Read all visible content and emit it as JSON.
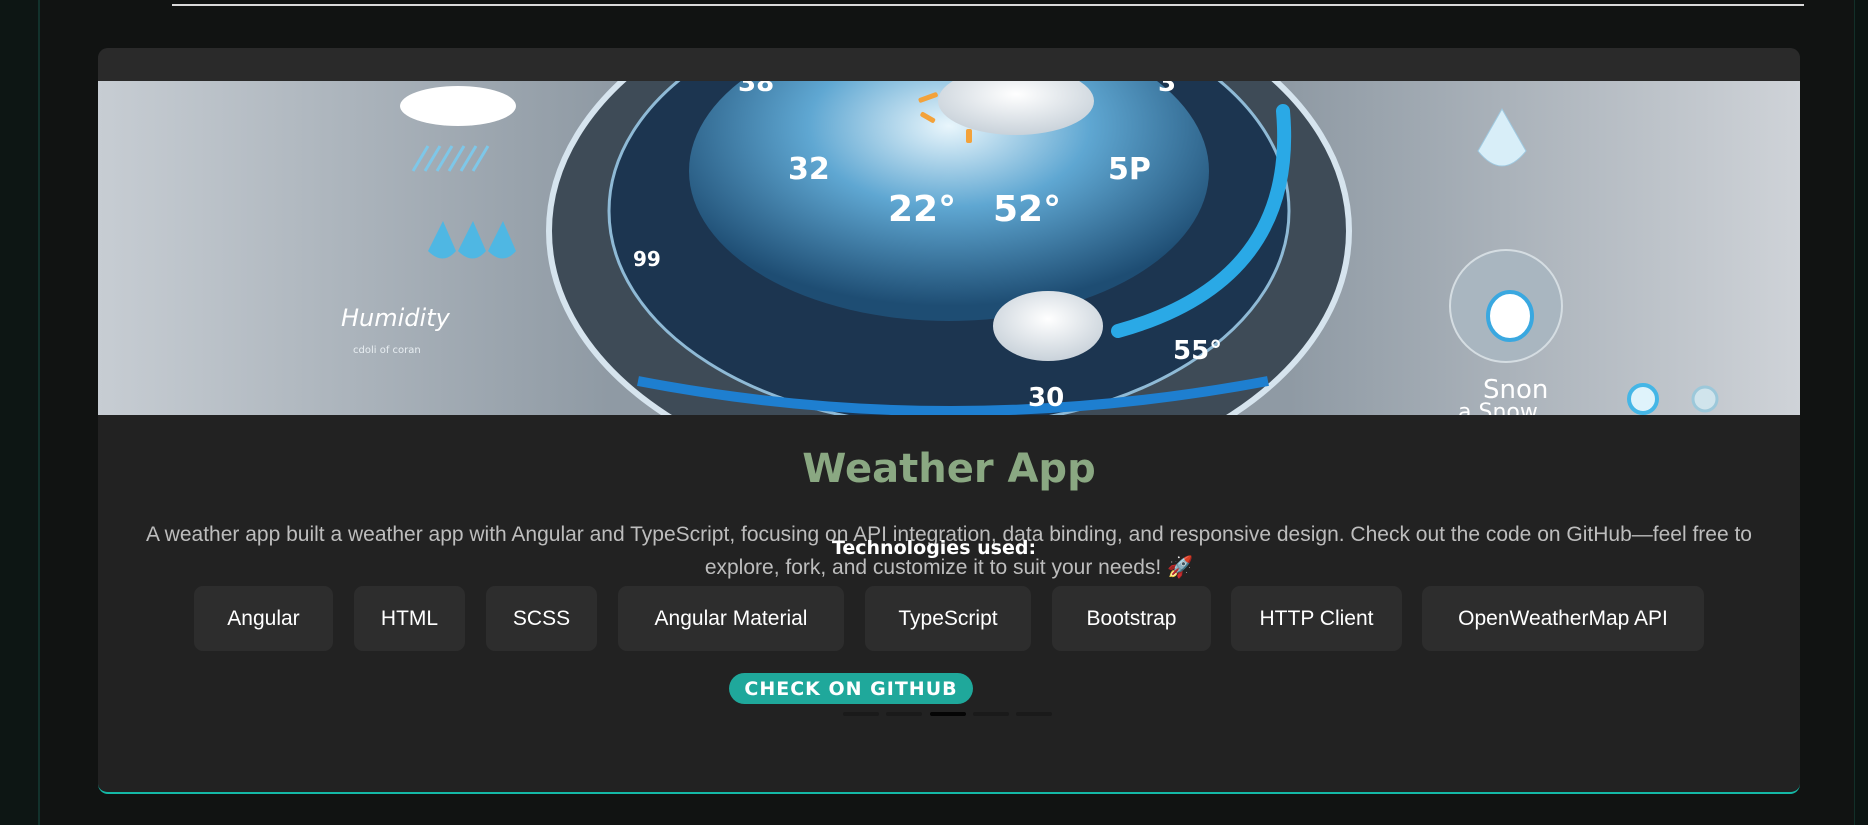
{
  "project": {
    "title": "Weather App",
    "description": "A weather app built a weather app with Angular and TypeScript, focusing on API integration, data binding, and responsive design. Check out the code on GitHub—feel free to explore, fork, and customize it to suit your needs! 🚀",
    "technologies_heading": "Technologies used:",
    "technologies": [
      "Angular",
      "HTML",
      "SCSS",
      "Angular Material",
      "TypeScript",
      "Bootstrap",
      "HTTP Client",
      "OpenWeatherMap API"
    ],
    "github_button": "CHECK ON GITHUB",
    "carousel": {
      "total": 5,
      "active": 3
    }
  },
  "banner": {
    "temps": [
      "38",
      "3",
      "32",
      "22°",
      "52°",
      "5P",
      "99",
      "55°",
      "30"
    ],
    "humidity_label": "Humidity",
    "humidity_sub": "cdoli of coran",
    "snow_label": "Snon",
    "snow_sub": "a Snow"
  },
  "colors": {
    "accent": "#1fa89b",
    "title": "#8aa882",
    "card": "#222222",
    "chip": "#2d2d2d",
    "background": "#111312"
  }
}
